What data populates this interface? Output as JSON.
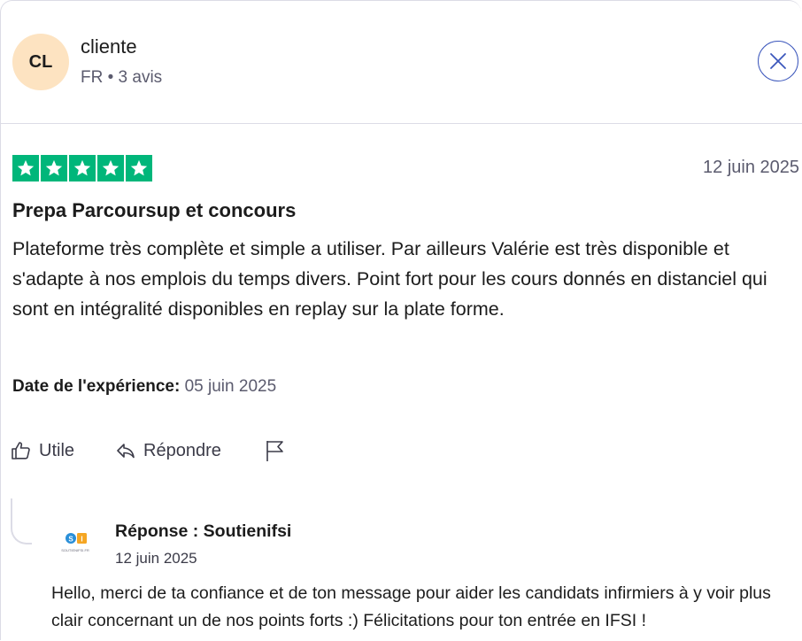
{
  "user": {
    "initials": "CL",
    "name": "cliente",
    "meta": "FR • 3 avis"
  },
  "review": {
    "rating": 5,
    "date": "12 juin 2025",
    "title": "Prepa Parcoursup et concours",
    "body": "Plateforme très complète et simple a utiliser. Par ailleurs Valérie est très disponible et s'adapte à nos emplois du temps divers. Point fort pour les cours donnés en distanciel qui sont en intégralité disponibles en replay sur la plate forme.",
    "experience_label": "Date de l'expérience:",
    "experience_value": "05 juin 2025"
  },
  "actions": {
    "useful_label": "Utile",
    "reply_label": "Répondre"
  },
  "reply": {
    "logo_text": "SOUTIENIFSI.FR",
    "name": "Réponse : Soutienifsi",
    "date": "12 juin 2025",
    "body": "Hello, merci de ta confiance et de ton message pour aider les candidats infirmiers à y voir plus clair concernant un de nos points forts :) Félicitations pour ton entrée en IFSI !"
  },
  "colors": {
    "star_green": "#00b67a",
    "avatar_bg": "#fde3c1",
    "close_blue": "#3c57bc",
    "muted_text": "#5b5b6e"
  }
}
